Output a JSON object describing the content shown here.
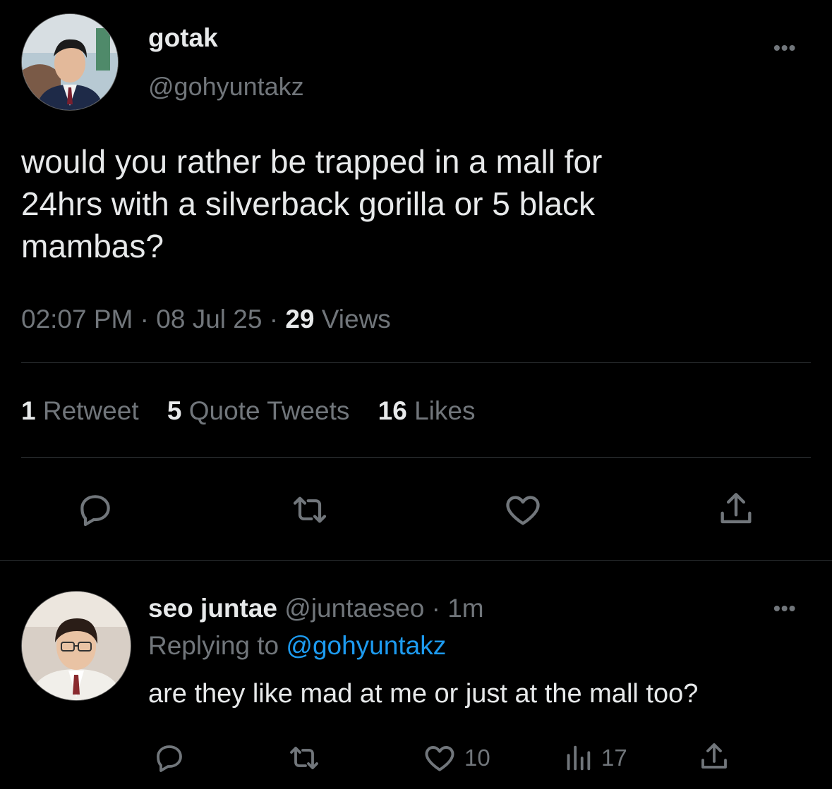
{
  "tweet": {
    "display_name": "gotak",
    "handle": "@gohyuntakz",
    "text_lines": [
      "would you rather be trapped in a mall for",
      "24hrs with a silverback gorilla or 5 black",
      "mambas?"
    ],
    "time": "02:07 PM",
    "sep1": "·",
    "date": "08 Jul 25",
    "sep2": "·",
    "views_count": "29",
    "views_label": "Views",
    "retweets_count": "1",
    "retweets_label": "Retweet",
    "quotes_count": "5",
    "quotes_label": "Quote Tweets",
    "likes_count": "16",
    "likes_label": "Likes",
    "more_label": "•••"
  },
  "reply": {
    "display_name": "seo juntae",
    "handle": "@juntaeseo",
    "sep": "·",
    "time": "1m",
    "replying_prefix": "Replying to",
    "replying_handle": "@gohyuntakz",
    "text": "are they like mad at me or just at the mall too?",
    "likes": "10",
    "views": "17",
    "more_label": "•••"
  },
  "icons": {
    "reply": "reply-icon",
    "retweet": "retweet-icon",
    "like": "heart-icon",
    "share": "share-icon",
    "views": "analytics-icon"
  },
  "colors": {
    "background": "#000000",
    "text": "#e7e9ea",
    "muted": "#71767b",
    "link": "#1d9bf0",
    "divider": "#2f3336"
  }
}
